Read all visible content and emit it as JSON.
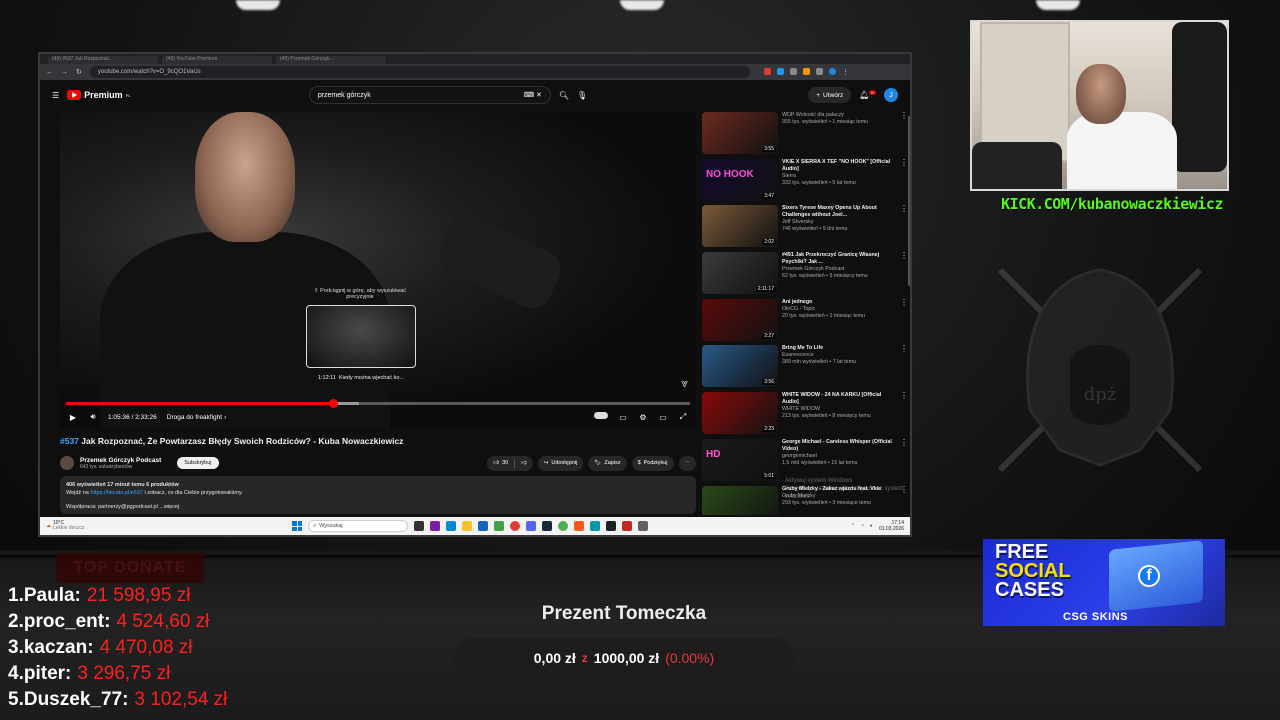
{
  "browser": {
    "url": "youtube.com/watch?v=O_9cQO1VaUs",
    "tabs": [
      "(49) #537 Jak Rozpoznać...",
      "(49) YouTube Premium",
      "(49) Przemek Górczyk..."
    ]
  },
  "youtube": {
    "logo": "Premium",
    "logo_badge": "PL",
    "search_value": "przemek górczyk",
    "create_label": "Utwórz",
    "notif_count": "9+",
    "avatar_letter": "J"
  },
  "player": {
    "hover_tip": "⇧ Podciągnij w górę, aby wyszukiwać precyzyjnie",
    "preview_time": "1:12:11",
    "preview_chapter": "Kiedy można wjechać ko...",
    "current_time": "1:05:36",
    "duration": "2:33:26",
    "time_display": "1:05:36 / 2:33:26",
    "chapter": "Droga do freakfight",
    "progress_fraction": 0.428,
    "buffered_fraction": 0.47
  },
  "video": {
    "hash_tag": "#537",
    "title": "Jak Rozpoznać, Że Powtarzasz Błędy Swoich Rodziców? - Kuba Nowaczkiewicz",
    "channel": "Przemek Górczyk Podcast",
    "subscribers": "643 tys. subskrybentów",
    "subscribe_label": "Subskrybuj",
    "likes": "30",
    "share_label": "Udostępnij",
    "save_label": "Zapisz",
    "thanks_label": "Podziękuj",
    "desc_stats": "406 wyświetleń  17 minut temu  6 produktów",
    "desc_line1_pre": "Wejdź na ",
    "desc_link": "https://hecato.pl/e537",
    "desc_line1_post": " i zobacz, co dla Ciebie przygotowaliśmy.",
    "desc_line2": "Współpraca: partnerzy@pgpodcast.pl  ...więcej"
  },
  "recommendations": [
    {
      "title": "",
      "channel": "WDP Wolność dla palaczy",
      "meta": "355 tys. wyświetleń • 1 miesiąc temu",
      "duration": "3:55",
      "color": "#6b2a1e",
      "overlay": ""
    },
    {
      "title": "VKIE X SIERRA X TEF \"NO HOOK\" [Official Audio]",
      "channel": "Sierra",
      "meta": "333 tys. wyświetleń • 5 lat temu",
      "duration": "3:47",
      "color": "#140a2e",
      "overlay": "NO HOOK"
    },
    {
      "title": "Sixers Tyrese Maxey Opens Up About Challenges without Joel...",
      "channel": "Jeff Skversky",
      "meta": "746 wyświetleń • 9 dni temu",
      "duration": "2:02",
      "color": "#7a5a3a",
      "overlay": ""
    },
    {
      "title": "#491 Jak Przekroczyć Granicę Własnej Psychiki? Jak ...",
      "channel": "Przemek Górczyk Podcast",
      "meta": "62 tys. wyświetleń • 5 miesięcy temu",
      "duration": "2:11:17",
      "color": "#3b3b3b",
      "overlay": ""
    },
    {
      "title": "Ani jednego",
      "channel": "OleCG - Topic",
      "meta": "20 tys. wyświetleń • 1 miesiąc temu",
      "duration": "2:27",
      "color": "#5a0a0a",
      "overlay": ""
    },
    {
      "title": "Bring Me To Life",
      "channel": "Evanescence",
      "meta": "389 mln wyświetleń • 7 lat temu",
      "duration": "3:56",
      "color": "#2a5a8a",
      "overlay": ""
    },
    {
      "title": "WHITE WIDOW - 24 NA KARKU [Official Audio]",
      "channel": "WHITE WIDOW",
      "meta": "213 tys. wyświetleń • 8 miesięcy temu",
      "duration": "2:23",
      "color": "#8a0a0a",
      "overlay": ""
    },
    {
      "title": "George Michael - Careless Whisper (Official Video)",
      "channel": "georgemichael",
      "meta": "1,5 mld wyświetleń • 15 lat temu",
      "duration": "5:01",
      "color": "#1a1a1a",
      "overlay": "HD"
    },
    {
      "title": "Gruby Mielzky - Zakaz wjazdu feat. Vkie",
      "channel": "Gruby Mielzky",
      "meta": "293 tys. wyświetleń • 3 miesiące temu",
      "duration": "3:39",
      "color": "#2a4a1a",
      "overlay": ""
    }
  ],
  "windows_watermark": [
    "Aktywuj system Windows",
    "Przejdź do ustawień, aby aktywować system Windows."
  ],
  "taskbar": {
    "temp": "10°C",
    "weather": "Lekkie deszcz",
    "search_placeholder": "Wyszukaj",
    "time": "17:14",
    "date": "01.03.2026"
  },
  "overlay": {
    "kick_url": "KICK.COM/kubanowaczkiewicz",
    "emblem_text": "dpż",
    "ad": {
      "line1": "FREE",
      "line2": "SOCIAL",
      "line3": "CASES",
      "brand": "CSG  SKINS",
      "fb": "f"
    },
    "top_donate_label": "TOP DONATE",
    "donors": [
      {
        "rank": "1.",
        "name": "Paula:",
        "amount": "21 598,95 zł"
      },
      {
        "rank": "2.",
        "name": "proc_ent:",
        "amount": "4 524,60 zł"
      },
      {
        "rank": "3.",
        "name": "kaczan:",
        "amount": "4 470,08 zł"
      },
      {
        "rank": "4.",
        "name": "piter:",
        "amount": "3 296,75 zł"
      },
      {
        "rank": "5.",
        "name": "Duszek_77:",
        "amount": "3 102,54 zł"
      }
    ],
    "gift": {
      "title": "Prezent Tomeczka",
      "current": "0,00 zł",
      "separator": "z",
      "goal": "1000,00 zł",
      "percent": "(0.00%)"
    }
  },
  "colors": {
    "kick_green": "#53fc18",
    "donate_red": "#ff1f1f",
    "yt_red": "#ff0000",
    "ad_blue": "#1a2bd6"
  }
}
